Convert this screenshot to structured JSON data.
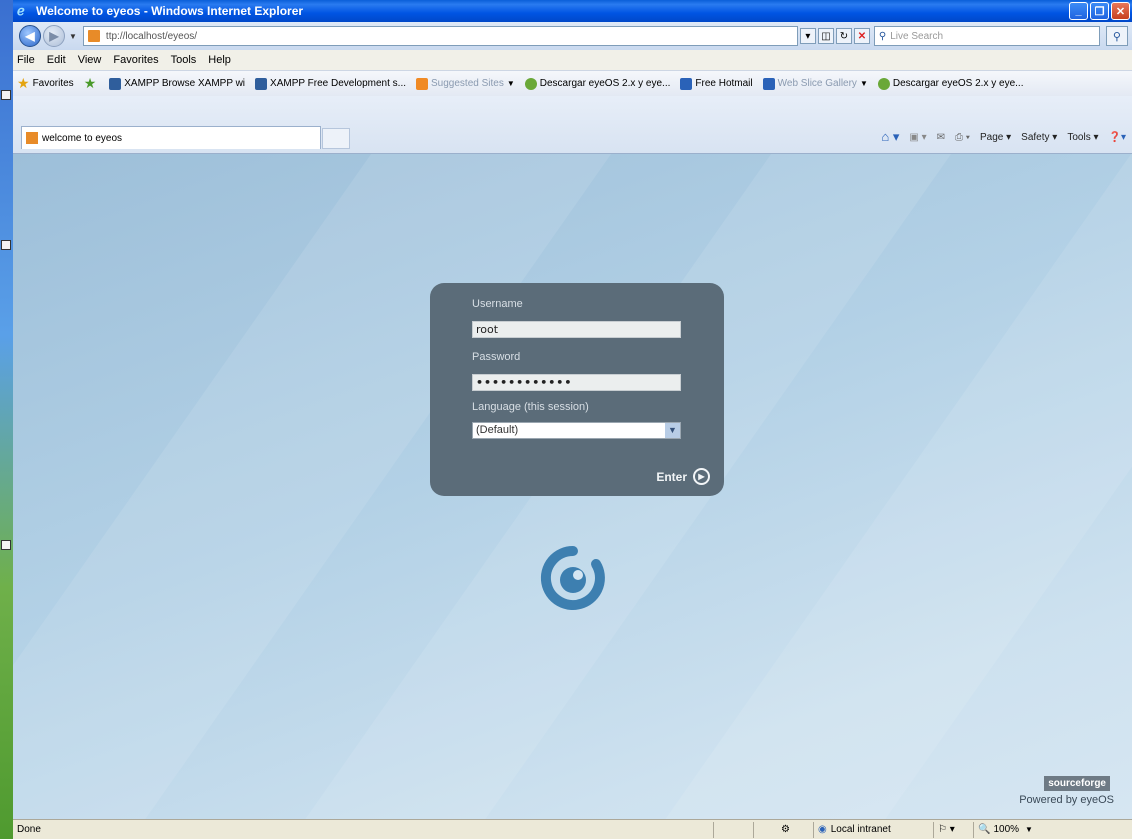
{
  "window": {
    "title": "Welcome to eyeos - Windows Internet Explorer"
  },
  "address": {
    "url": "ttp://localhost/eyeos/",
    "search_placeholder": "Live Search"
  },
  "menu": [
    "File",
    "Edit",
    "View",
    "Favorites",
    "Tools",
    "Help"
  ],
  "favorites": {
    "label": "Favorites",
    "items": [
      {
        "label": "XAMPP Browse XAMPP wi",
        "color": "#2f5e9c"
      },
      {
        "label": "XAMPP Free Development s...",
        "color": "#2f5e9c"
      },
      {
        "label": "Suggested Sites",
        "color": "#f08a24"
      },
      {
        "label": "Descargar eyeOS 2.x y eye...",
        "color": "#6aa838"
      },
      {
        "label": "Free Hotmail",
        "color": "#2a62b8"
      },
      {
        "label": "Web Slice Gallery",
        "color": "#2a62b8"
      },
      {
        "label": "Descargar eyeOS 2.x y eye...",
        "color": "#6aa838"
      }
    ]
  },
  "tab": {
    "label": "welcome to eyeos"
  },
  "commandbar": {
    "page": "Page",
    "safety": "Safety",
    "tools": "Tools"
  },
  "login": {
    "username_label": "Username",
    "username_value": "root",
    "password_label": "Password",
    "password_value": "••••••••••••",
    "language_label": "Language (this session)",
    "language_value": "(Default)",
    "enter_label": "Enter"
  },
  "footer": {
    "sf_badge": "sourceforge",
    "powered": "Powered by eyeOS"
  },
  "status": {
    "text": "Done",
    "zone": "Local intranet",
    "zoom": "100%"
  },
  "colors": {
    "panel": "#5b6c79",
    "logo": "#3d7fb0",
    "title_bar": "#0054e3"
  }
}
